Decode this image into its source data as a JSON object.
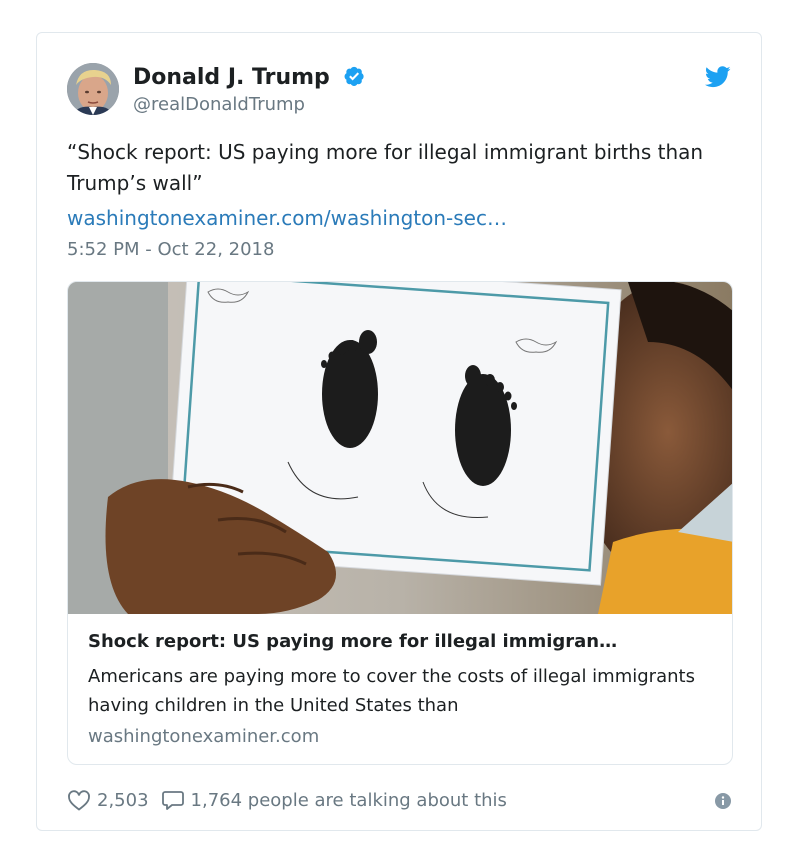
{
  "author": {
    "name": "Donald J. Trump",
    "handle": "@realDonaldTrump"
  },
  "tweet": {
    "text": "“Shock report: US paying more for illegal immigrant births than Trump’s wall”",
    "link": "washingtonexaminer.com/washington-sec…",
    "timestamp": "5:52 PM - Oct 22, 2018"
  },
  "card": {
    "title": "Shock report: US paying more for illegal immigran…",
    "description": "Americans are paying more to cover the costs of illegal immigrants having children in the United States than",
    "domain": "washingtonexaminer.com"
  },
  "actions": {
    "likes": "2,503",
    "conversation": "1,764 people are talking about this"
  },
  "icons": {
    "verified": "verified-badge-icon",
    "logo": "twitter-bird-icon",
    "like": "heart-icon",
    "reply": "speech-bubble-icon",
    "info": "info-icon"
  },
  "colors": {
    "link": "#2b7bb9",
    "muted": "#697882",
    "brand": "#1da1f2",
    "border": "#e1e8ed"
  }
}
